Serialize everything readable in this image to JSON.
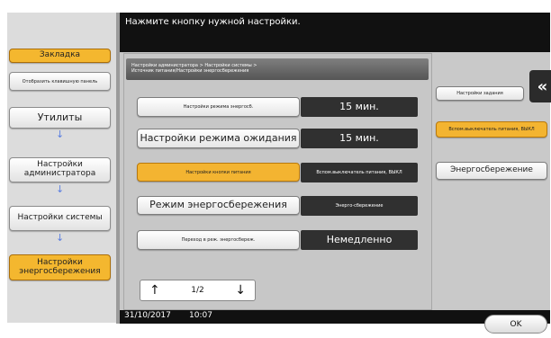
{
  "header": {
    "message": "Нажмите кнопку нужной настройки."
  },
  "breadcrumb": {
    "line1": "Настройки администратора > Настройки системы >",
    "line2": "Источник питания/Настройки энергосбережения"
  },
  "sidebar": {
    "items": [
      {
        "label": "Закладка"
      },
      {
        "label": "Отобразить клавишную панель"
      },
      {
        "label": "Утилиты"
      },
      {
        "label": "Настройки администратора"
      },
      {
        "label": "Настройки системы"
      },
      {
        "label": "Настройки энергосбережения"
      }
    ]
  },
  "settings": [
    {
      "label": "Настройки режима энергосб.",
      "value": "15 мин."
    },
    {
      "label": "Настройки режима ожидания",
      "value": "15 мин."
    },
    {
      "label": "Настройки кнопки питания",
      "value": "Вспом.выключатель питания, ВЫКЛ"
    },
    {
      "label": "Режим энергосбережения",
      "value": "Энерго-сбережение"
    },
    {
      "label": "Переход в реж. энергосбереж.",
      "value": "Немедленно"
    }
  ],
  "pager": {
    "up": "↑",
    "page": "1/2",
    "down": "↓"
  },
  "right_panel": {
    "title": "Настройки задания",
    "option1": "Вспом.выключатель питания, ВЫКЛ",
    "option2": "Энергосбережение"
  },
  "status": {
    "date": "31/10/2017",
    "time": "10:07",
    "ok": "OK"
  },
  "icons": {
    "back": "back-arrows-icon"
  }
}
